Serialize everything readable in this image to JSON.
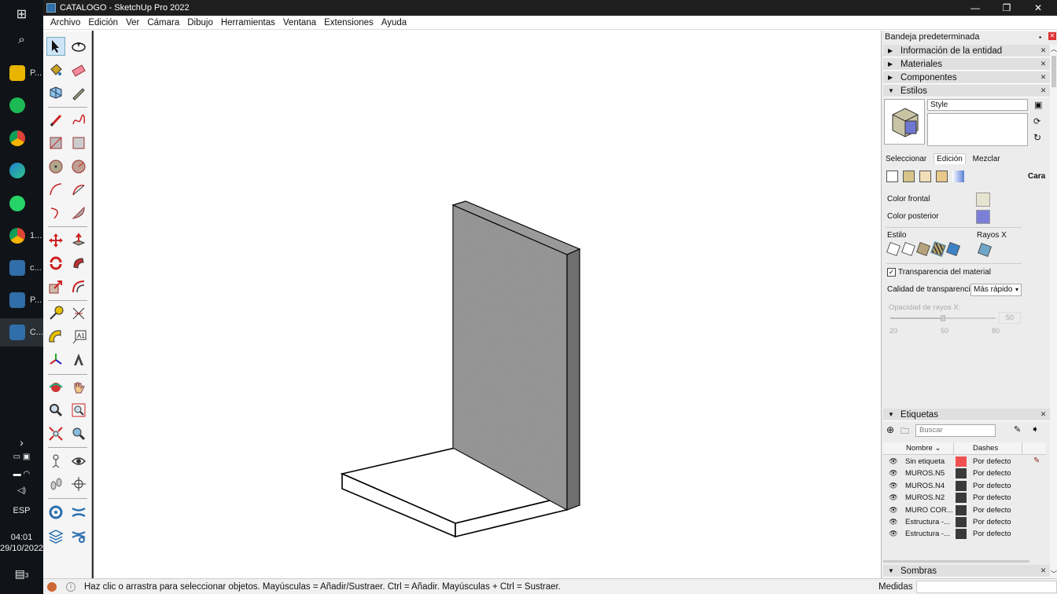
{
  "window": {
    "title": "CATALOGO - SketchUp Pro 2022"
  },
  "menu": [
    "Archivo",
    "Edición",
    "Ver",
    "Cámara",
    "Dibujo",
    "Herramientas",
    "Ventana",
    "Extensiones",
    "Ayuda"
  ],
  "taskbar": {
    "items": [
      {
        "label": "P...",
        "color": "#e8b400"
      },
      {
        "label": "",
        "color": "#1db954"
      },
      {
        "label": "",
        "color": "#db4437"
      },
      {
        "label": "",
        "color": "#1f7fd0"
      },
      {
        "label": "",
        "color": "#25d366"
      },
      {
        "label": "1...",
        "color": "#db4437"
      },
      {
        "label": "c...",
        "color": "#2f6ea8"
      },
      {
        "label": "P...",
        "color": "#2f6ea8"
      },
      {
        "label": "C...",
        "color": "#2f6ea8"
      }
    ],
    "lang": "ESP",
    "time": "04:01",
    "date": "29/10/2022",
    "notif": "3"
  },
  "tray": {
    "title": "Bandeja predeterminada",
    "sections": [
      "Información de la entidad",
      "Materiales",
      "Componentes",
      "Estilos"
    ],
    "style_name": "Style",
    "tabs": [
      "Seleccionar",
      "Edición",
      "Mezclar"
    ],
    "face_label": "Cara",
    "front_color_label": "Color frontal",
    "back_color_label": "Color posterior",
    "front_color": "#e4e4d0",
    "back_color": "#7b7fd8",
    "style_label": "Estilo",
    "xray_label": "Rayos X",
    "transparency_label": "Transparencia del material",
    "quality_label": "Calidad de transparencia:",
    "quality_value": "Más rápido",
    "opacity_label": "Opacidad de rayos X:",
    "opacity_value": "50",
    "opacity_min": "20",
    "opacity_mid": "50",
    "opacity_max": "80",
    "tags_title": "Etiquetas",
    "search_placeholder": "Buscar",
    "col_name": "Nombre",
    "col_dashes": "Dashes",
    "tags": [
      {
        "name": "Sin etiqueta",
        "color": "#f05050",
        "dash": "Por defecto"
      },
      {
        "name": "MUROS.N5",
        "color": "#3a3a3a",
        "dash": "Por defecto"
      },
      {
        "name": "MUROS.N4",
        "color": "#3a3a3a",
        "dash": "Por defecto"
      },
      {
        "name": "MUROS.N2",
        "color": "#3a3a3a",
        "dash": "Por defecto"
      },
      {
        "name": "MURO COR...",
        "color": "#3a3a3a",
        "dash": "Por defecto"
      },
      {
        "name": "Estructura -...",
        "color": "#3a3a3a",
        "dash": "Por defecto"
      },
      {
        "name": "Estructura -...",
        "color": "#3a3a3a",
        "dash": "Por defecto"
      }
    ],
    "shadows_title": "Sombras"
  },
  "status": {
    "message": "Haz clic o arrastra para seleccionar objetos. Mayúsculas = Añadir/Sustraer. Ctrl = Añadir. Mayúsculas + Ctrl = Sustraer.",
    "measure_label": "Medidas"
  }
}
